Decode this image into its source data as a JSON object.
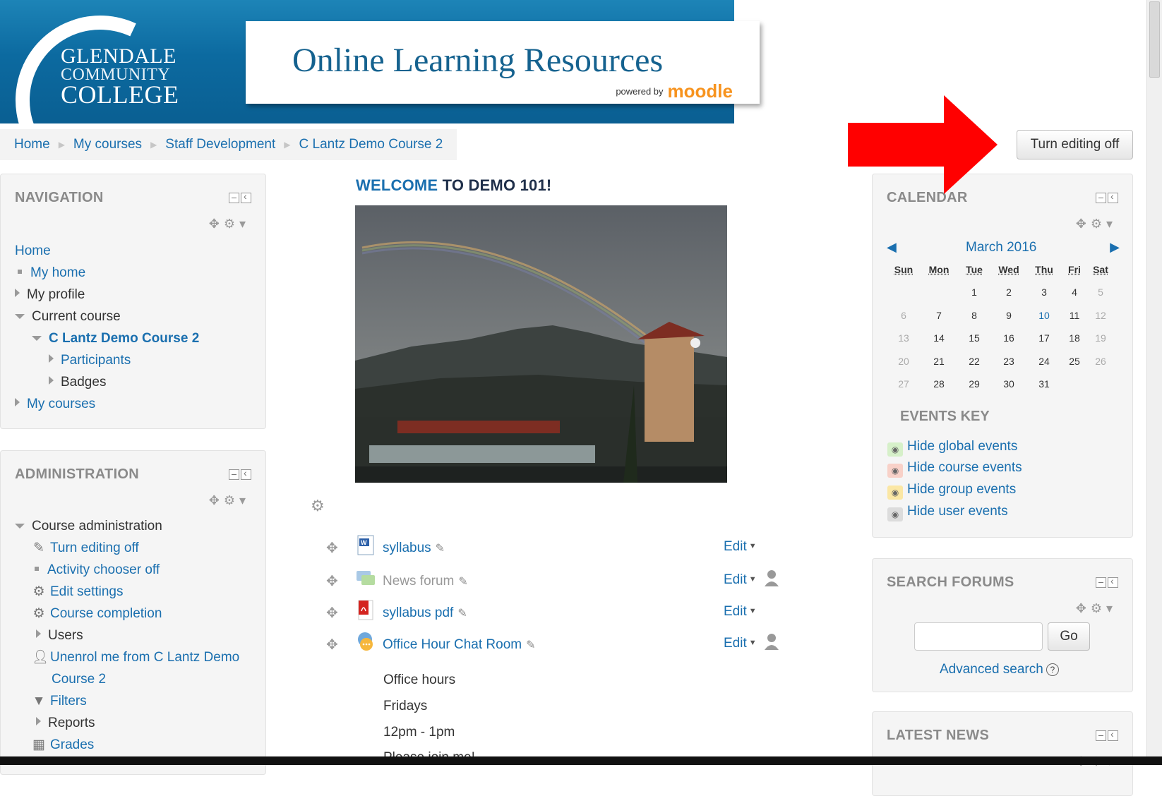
{
  "header": {
    "college_line1": "GLENDALE",
    "college_line2": "COMMUNITY",
    "college_line3": "COLLEGE",
    "site_title": "Online Learning Resources",
    "powered_by": "powered by",
    "moodle": "moodle"
  },
  "breadcrumb": [
    "Home",
    "My courses",
    "Staff Development",
    "C Lantz Demo Course 2"
  ],
  "edit_toggle_label": "Turn editing off",
  "navigation": {
    "title": "NAVIGATION",
    "home": "Home",
    "my_home": "My home",
    "my_profile": "My profile",
    "current_course": "Current course",
    "course_name": "C Lantz Demo Course 2",
    "participants": "Participants",
    "badges": "Badges",
    "my_courses": "My courses"
  },
  "administration": {
    "title": "ADMINISTRATION",
    "course_admin": "Course administration",
    "turn_editing_off": "Turn editing off",
    "activity_chooser_off": "Activity chooser off",
    "edit_settings": "Edit settings",
    "course_completion": "Course completion",
    "users": "Users",
    "unenrol_line1": "Unenrol me from C Lantz Demo",
    "unenrol_line2": "Course 2",
    "filters": "Filters",
    "reports": "Reports",
    "grades": "Grades"
  },
  "main": {
    "welcome_a": "WELCOME",
    "welcome_b": " TO DEMO 101!",
    "activities": [
      {
        "name": "syllabus",
        "icon": "word-doc-icon",
        "edit": "Edit",
        "hidden": false
      },
      {
        "name": "News forum",
        "icon": "forum-icon",
        "edit": "Edit",
        "hidden": true
      },
      {
        "name": "syllabus pdf",
        "icon": "pdf-icon",
        "edit": "Edit",
        "hidden": false
      },
      {
        "name": "Office Hour Chat Room",
        "icon": "chat-icon",
        "edit": "Edit",
        "hidden": false
      }
    ],
    "description": [
      "Office hours",
      "Fridays",
      "12pm - 1pm",
      "Please join me!"
    ]
  },
  "calendar": {
    "title": "CALENDAR",
    "month": "March 2016",
    "days": [
      "Sun",
      "Mon",
      "Tue",
      "Wed",
      "Thu",
      "Fri",
      "Sat"
    ],
    "weeks": [
      [
        "",
        "",
        "1",
        "2",
        "3",
        "4",
        "5"
      ],
      [
        "6",
        "7",
        "8",
        "9",
        "10",
        "11",
        "12"
      ],
      [
        "13",
        "14",
        "15",
        "16",
        "17",
        "18",
        "19"
      ],
      [
        "20",
        "21",
        "22",
        "23",
        "24",
        "25",
        "26"
      ],
      [
        "27",
        "28",
        "29",
        "30",
        "31",
        "",
        ""
      ]
    ],
    "today": "10",
    "events_key_title": "EVENTS KEY",
    "events": [
      {
        "label": "Hide global events",
        "color": "#d6f0c9"
      },
      {
        "label": "Hide course events",
        "color": "#f8d1c8"
      },
      {
        "label": "Hide group events",
        "color": "#fbe7a4"
      },
      {
        "label": "Hide user events",
        "color": "#dcdcdc"
      }
    ]
  },
  "search_forums": {
    "title": "SEARCH FORUMS",
    "go": "Go",
    "advanced": "Advanced search",
    "help": "?"
  },
  "latest_news": {
    "title": "LATEST NEWS"
  },
  "colors": {
    "link": "#1a6faf",
    "banner": "#0c6aa0",
    "arrow": "#ff0000"
  }
}
